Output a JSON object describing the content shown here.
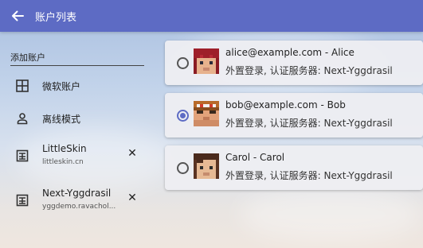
{
  "header": {
    "title": "账户列表"
  },
  "sidebar": {
    "section_title": "添加账户",
    "items": [
      {
        "label": "微软账户",
        "icon": "grid-icon"
      },
      {
        "label": "离线模式",
        "icon": "person-icon"
      },
      {
        "label": "LittleSkin",
        "sub": "littleskin.cn",
        "icon": "server-icon"
      },
      {
        "label": "Next-Yggdrasil",
        "sub": "yggdemo.ravachol...",
        "icon": "server-icon"
      }
    ]
  },
  "accounts": [
    {
      "title": "alice@example.com - Alice",
      "sub": "外置登录, 认证服务器: Next-Yggdrasil",
      "selected": false
    },
    {
      "title": "bob@example.com - Bob",
      "sub": "外置登录, 认证服务器: Next-Yggdrasil",
      "selected": true
    },
    {
      "title": "Carol - Carol",
      "sub": "外置登录, 认证服务器: Next-Yggdrasil",
      "selected": false
    }
  ],
  "colors": {
    "accent": "#5d6bc4"
  }
}
